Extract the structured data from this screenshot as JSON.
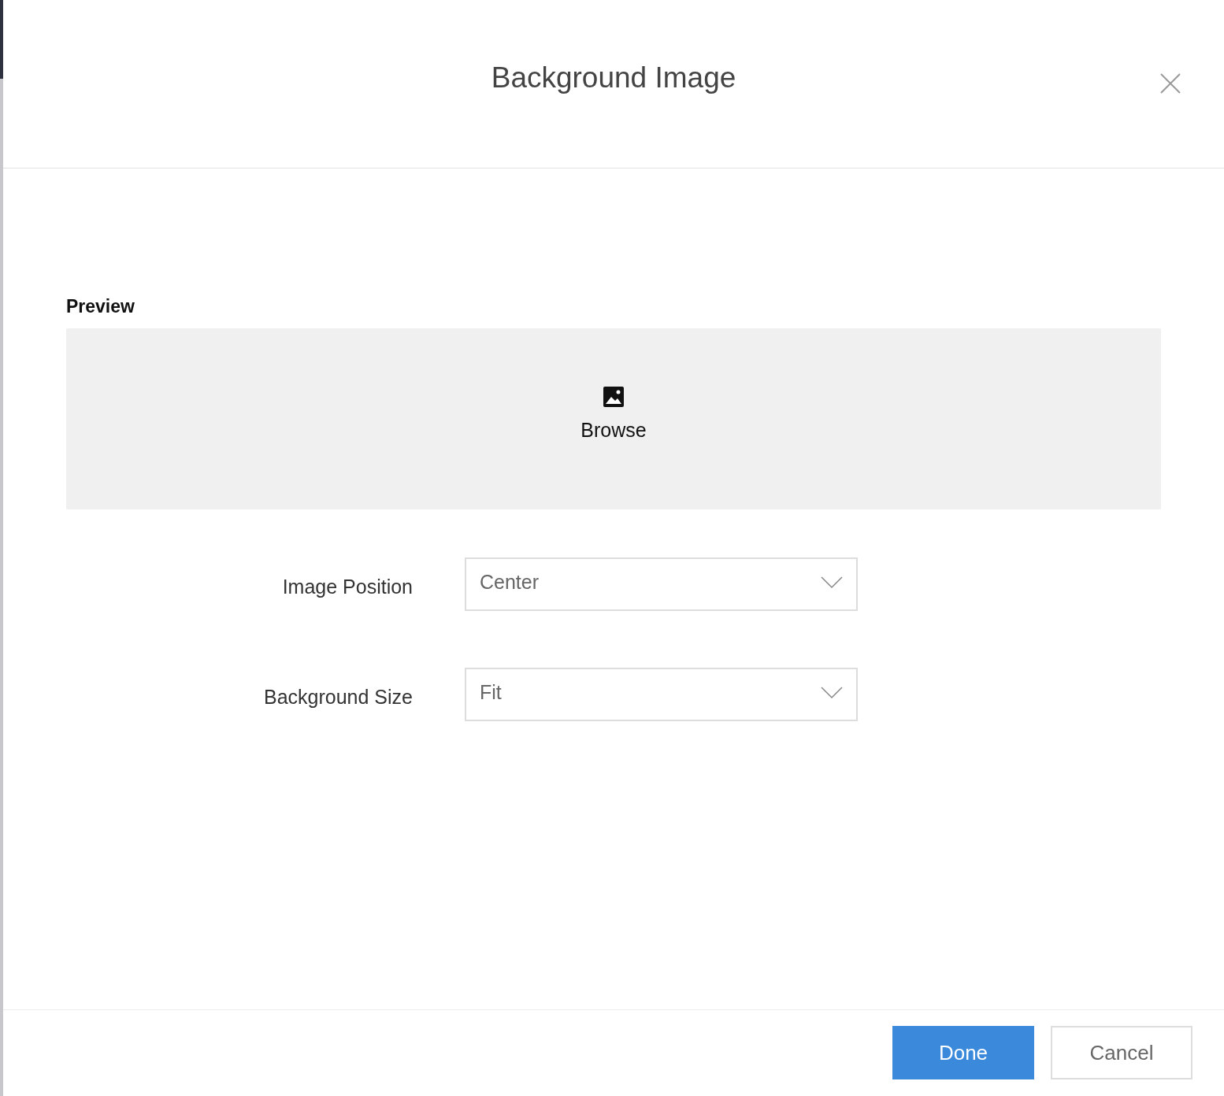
{
  "dialog": {
    "title": "Background Image"
  },
  "preview": {
    "label": "Preview",
    "browse": "Browse"
  },
  "fields": [
    {
      "label": "Image Position",
      "value": "Center"
    },
    {
      "label": "Background Size",
      "value": "Fit"
    }
  ],
  "buttons": [
    {
      "label": "Done",
      "kind": "primary"
    },
    {
      "label": "Cancel",
      "kind": "secondary"
    }
  ]
}
